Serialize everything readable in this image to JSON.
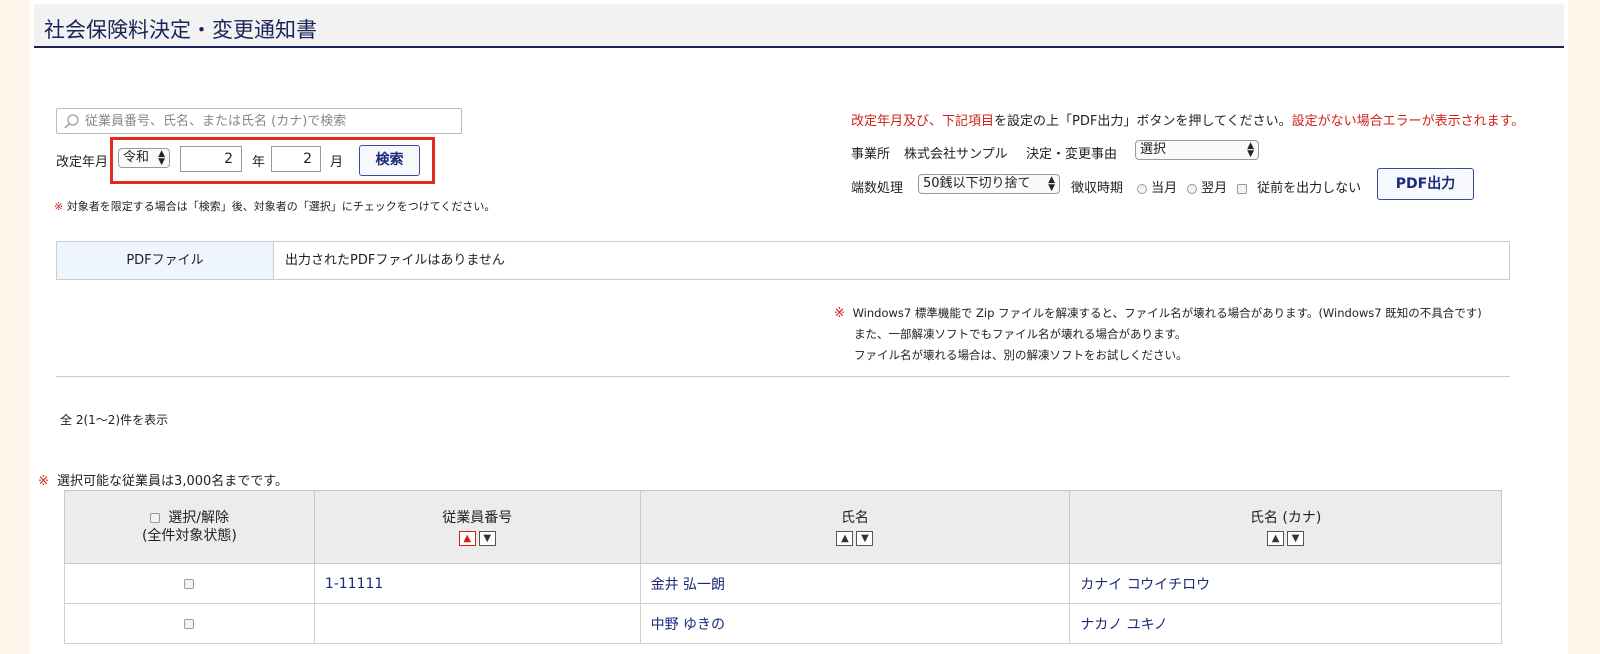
{
  "page": {
    "title": "社会保険料決定・変更通知書"
  },
  "search": {
    "placeholder": "従業員番号、氏名、または氏名 (カナ)で検索",
    "revision_label": "改定年月",
    "era": "令和",
    "year": "2",
    "year_unit": "年",
    "month": "2",
    "month_unit": "月",
    "search_button": "検索",
    "note_mark": "※",
    "note": "対象者を限定する場合は「検索」後、対象者の「選択」にチェックをつけてください。"
  },
  "instructions": {
    "red_part1": "改定年月及び、下記項目",
    "black_part": "を設定の上「PDF出力」ボタンを押してください。",
    "red_part2": "設定がない場合エラーが表示されます。"
  },
  "settings": {
    "office_label": "事業所",
    "office_value": "株式会社サンプル",
    "reason_label": "決定・変更事由",
    "reason_value": "選択",
    "rounding_label": "端数処理",
    "rounding_value": "50銭以下切り捨て",
    "collection_label": "徴収時期",
    "collection_option1": "当月",
    "collection_option2": "翌月",
    "prev_label": "従前を出力しない",
    "pdf_button": "PDF出力"
  },
  "pdf_file": {
    "label": "PDFファイル",
    "value": "出力されたPDFファイルはありません"
  },
  "zip_note": {
    "mark": "※",
    "line1": "Windows7 標準機能で Zip ファイルを解凍すると、ファイル名が壊れる場合があります。(Windows7 既知の不具合です)",
    "line2": "また、一部解凍ソフトでもファイル名が壊れる場合があります。",
    "line3": "ファイル名が壊れる場合は、別の解凍ソフトをお試しください。"
  },
  "results": {
    "count_text": "全 2(1〜2)件を表示",
    "limit_mark": "※",
    "limit_note": "選択可能な従業員は3,000名までです。"
  },
  "table": {
    "headers": {
      "select_line1": "選択/解除",
      "select_line2": "(全件対象状態)",
      "emp_no": "従業員番号",
      "name": "氏名",
      "kana": "氏名 (カナ)"
    },
    "rows": [
      {
        "emp_no": "1-11111",
        "name": "金井 弘一朗",
        "kana": "カナイ コウイチロウ"
      },
      {
        "emp_no": "",
        "name": "中野 ゆきの",
        "kana": "ナカノ ユキノ"
      }
    ]
  }
}
